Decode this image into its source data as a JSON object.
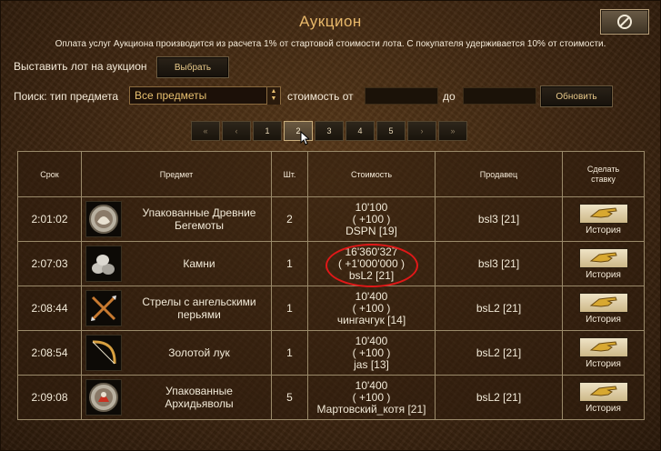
{
  "window": {
    "title": "Аукцион",
    "close_icon": "no-entry-icon",
    "notice": "Оплата услуг Аукциона производится из расчета 1% от стартовой стоимости лота. С покупателя удерживается 10% от стоимости."
  },
  "listing": {
    "label": "Выставить лот на аукцион",
    "choose_button": "Выбрать"
  },
  "search": {
    "label": "Поиск: тип предмета",
    "type_value": "Все предметы",
    "cost_from_label": "стоимость от",
    "cost_from_value": "",
    "cost_to_label": "до",
    "cost_to_value": "",
    "refresh_button": "Обновить"
  },
  "pagination": {
    "first": "«",
    "prev": "‹",
    "pages": [
      "1",
      "2",
      "3",
      "4",
      "5"
    ],
    "current_page": "2",
    "next": "›",
    "last": "»"
  },
  "table": {
    "headers": {
      "time": "Срок",
      "item": "Предмет",
      "qty": "Шт.",
      "cost": "Стоимость",
      "seller": "Продавец",
      "bid": "Сделать ставку"
    },
    "rows": [
      {
        "time": "2:01:02",
        "item": "Упакованные Древние Бегемоты",
        "icon": "behemoth-pack-icon",
        "qty": "2",
        "price": "10'100",
        "step": "( +100 )",
        "bidder": "DSPN [19]",
        "seller": "bsl3 [21]",
        "history": "История"
      },
      {
        "time": "2:07:03",
        "item": "Камни",
        "icon": "stones-icon",
        "qty": "1",
        "price": "16'360'327",
        "step": "( +1'000'000 )",
        "bidder": "bsL2 [21]",
        "seller": "bsl3 [21]",
        "history": "История"
      },
      {
        "time": "2:08:44",
        "item": "Стрелы с ангельскими перьями",
        "icon": "angel-arrows-icon",
        "qty": "1",
        "price": "10'400",
        "step": "( +100 )",
        "bidder": "чингачгук [14]",
        "seller": "bsL2 [21]",
        "history": "История"
      },
      {
        "time": "2:08:54",
        "item": "Золотой лук",
        "icon": "golden-bow-icon",
        "qty": "1",
        "price": "10'400",
        "step": "( +100 )",
        "bidder": "jas [13]",
        "seller": "bsL2 [21]",
        "history": "История"
      },
      {
        "time": "2:09:08",
        "item": "Упакованные Архидьяволы",
        "icon": "archdevil-pack-icon",
        "qty": "5",
        "price": "10'400",
        "step": "( +100 )",
        "bidder": "Мартовский_котя [21]",
        "seller": "bsL2 [21]",
        "history": "История"
      }
    ]
  },
  "colors": {
    "title": "#e8b86a",
    "highlight_circle": "#e01818",
    "background": "#3e2611"
  }
}
